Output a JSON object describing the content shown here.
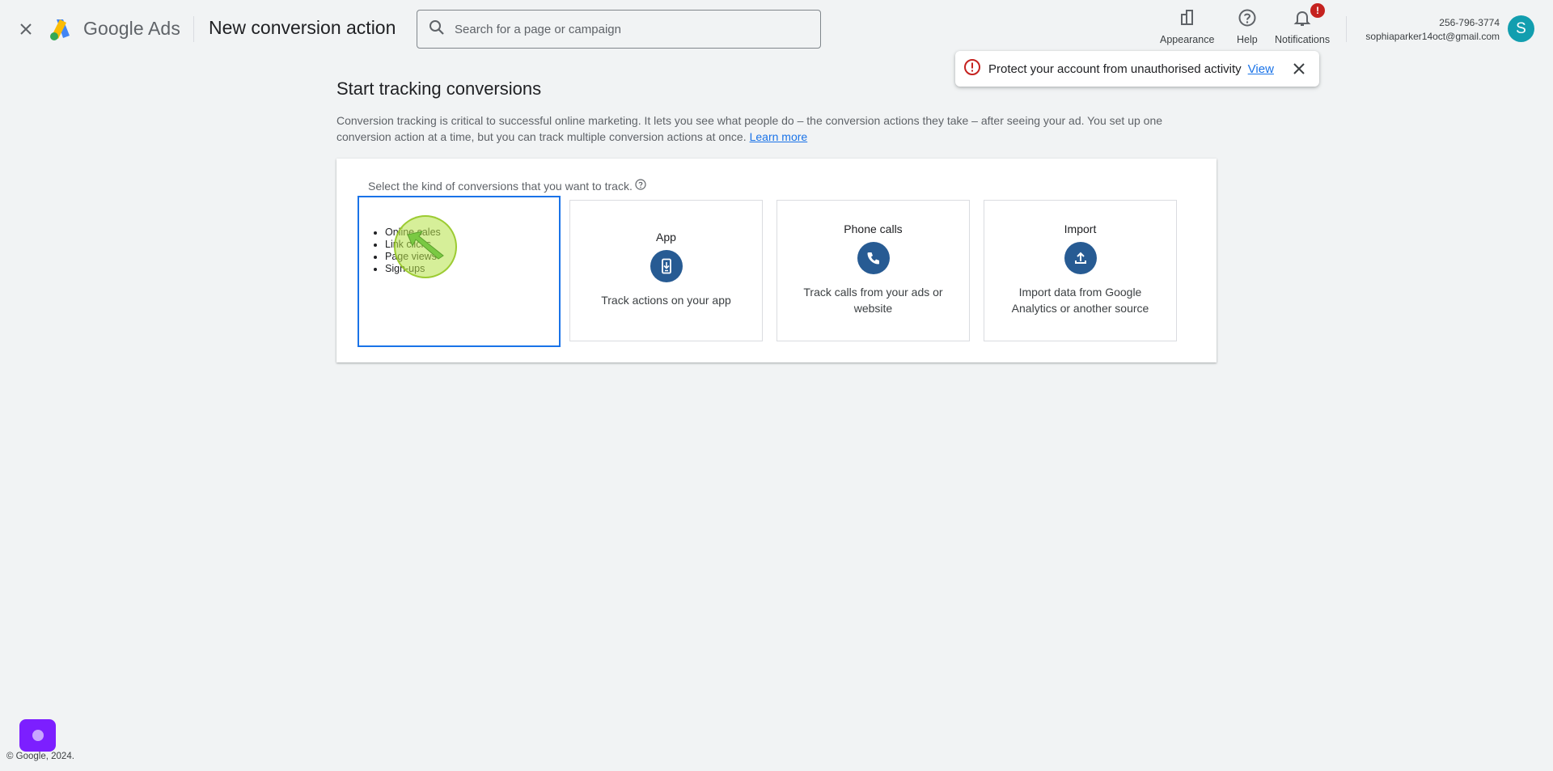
{
  "header": {
    "brand": "Google Ads",
    "page_title": "New conversion action",
    "search_placeholder": "Search for a page or campaign",
    "appearance_label": "Appearance",
    "help_label": "Help",
    "notifications_label": "Notifications",
    "notifications_badge": "!",
    "account_phone": "256-796-3774",
    "account_email": "sophiaparker14oct@gmail.com",
    "avatar_initial": "S"
  },
  "toast": {
    "message": "Protect your account from unauthorised activity",
    "link": "View"
  },
  "main": {
    "title": "Start tracking conversions",
    "intro_line1": "Conversion tracking is critical to successful online marketing. It lets you see what people do – the conversion actions they take – after seeing your ad. You set up one",
    "intro_line2": "conversion action at a time, but you can track multiple conversion actions at once.",
    "learn_more": "Learn more",
    "select_label": "Select the kind of conversions that you want to track."
  },
  "cards": {
    "website_items": [
      "Online sales",
      "Link clicks",
      "Page views",
      "Sign-ups"
    ],
    "app": {
      "title": "App",
      "desc": "Track actions on your app"
    },
    "phone": {
      "title": "Phone calls",
      "desc_line1": "Track calls from your ads or",
      "desc_line2": "website"
    },
    "import": {
      "title": "Import",
      "desc_line1": "Import data from Google",
      "desc_line2": "Analytics or another source"
    }
  },
  "footer": {
    "copyright": "© Google, 2024."
  },
  "colors": {
    "accent": "#1a73e8",
    "icon_circle": "#275b93",
    "error": "#c5221f",
    "avatar": "#129eaf"
  }
}
